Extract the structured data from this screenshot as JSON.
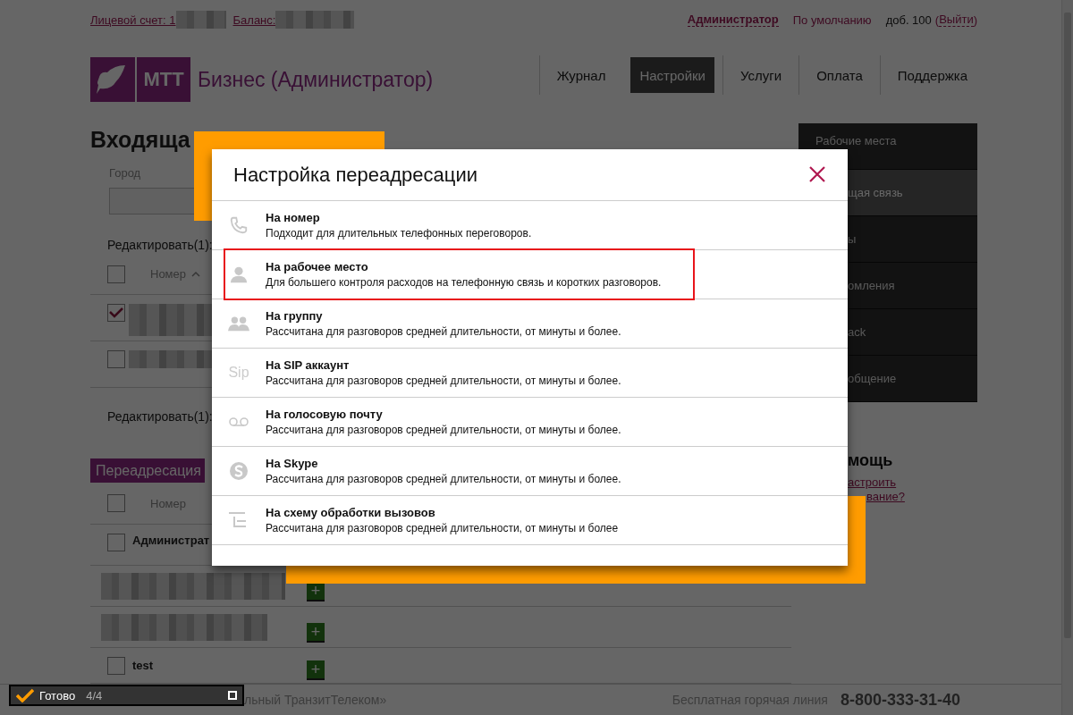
{
  "top_bar": {
    "account_label": "Лицевой счет: 1",
    "balance_label": "Баланс:",
    "user": "Администратор",
    "profile": "По умолчанию",
    "extension": "доб. 100",
    "logout_open": "(",
    "logout": "Выйти",
    "logout_close": ")"
  },
  "logo": {
    "mark": "МТТ",
    "title": "Бизнес (Администратор)"
  },
  "nav": [
    {
      "label": "Журнал",
      "selected": false
    },
    {
      "label": "Настройки",
      "selected": true
    },
    {
      "label": "Услуги",
      "selected": false
    },
    {
      "label": "Оплата",
      "selected": false
    },
    {
      "label": "Поддержка",
      "selected": false
    }
  ],
  "page_title": "Входяща",
  "filter": {
    "label": "Город"
  },
  "incoming": {
    "edit_label": "Редактировать(1):",
    "header": {
      "checked": false,
      "column": "Номер"
    },
    "rows": [
      {
        "checked": true
      },
      {
        "checked": false
      }
    ],
    "edit_label_bottom": "Редактировать(1):"
  },
  "forwarding": {
    "title": "Переадресация",
    "header": {
      "checked": false,
      "column": "Номер"
    },
    "rows": [
      {
        "kind": "named",
        "name": "Администрат",
        "checked": false
      },
      {
        "kind": "redacted",
        "add": "+"
      },
      {
        "kind": "redacted",
        "add": "+"
      },
      {
        "kind": "named",
        "name": "test",
        "checked": false,
        "add": "+"
      }
    ]
  },
  "sidebar": [
    {
      "label": "Рабочие места",
      "selected": false
    },
    {
      "label": "щая связь",
      "selected": true
    },
    {
      "label": "ы",
      "selected": false
    },
    {
      "label": "омления",
      "selected": false
    },
    {
      "label": "ack",
      "selected": false
    },
    {
      "label": "общение",
      "selected": false
    }
  ],
  "help": {
    "title": "мощь",
    "link_start": "астроить",
    "link_end": "вание?"
  },
  "footer": {
    "company": "льный ТранзитТелеком»",
    "hotline_label": "Бесплатная горячая линия",
    "hotline": "8-800-333-31-40"
  },
  "progress_widget": {
    "label": "Готово",
    "count": "4/4"
  },
  "modal": {
    "title": "Настройка переадресации",
    "options": [
      {
        "kind": "phone",
        "title": "На номер",
        "description": "Подходит для длительных телефонных переговоров.",
        "highlighted": false
      },
      {
        "kind": "person",
        "title": "На рабочее место",
        "description": "Для большего контроля расходов на телефонную связь и коротких разговоров.",
        "highlighted": true
      },
      {
        "kind": "group",
        "title": "На группу",
        "description": "Рассчитана для разговоров средней длительности, от минуты и более.",
        "highlighted": false
      },
      {
        "kind": "sip",
        "icon_text": "Sip",
        "title": "На SIP аккаунт",
        "description": "Рассчитана для разговоров средней длительности, от минуты и более.",
        "highlighted": false
      },
      {
        "kind": "voicemail",
        "title": "На голосовую почту",
        "description": "Рассчитана для разговоров средней длительности, от минуты и более.",
        "highlighted": false
      },
      {
        "kind": "skype",
        "title": "На Skype",
        "description": "Рассчитана для разговоров средней длительности, от минуты и более.",
        "highlighted": false
      },
      {
        "kind": "scheme",
        "title": "На схему обработки вызовов",
        "description": "Рассчитана для разговоров средней длительности, от минуты и более",
        "highlighted": false
      }
    ]
  }
}
